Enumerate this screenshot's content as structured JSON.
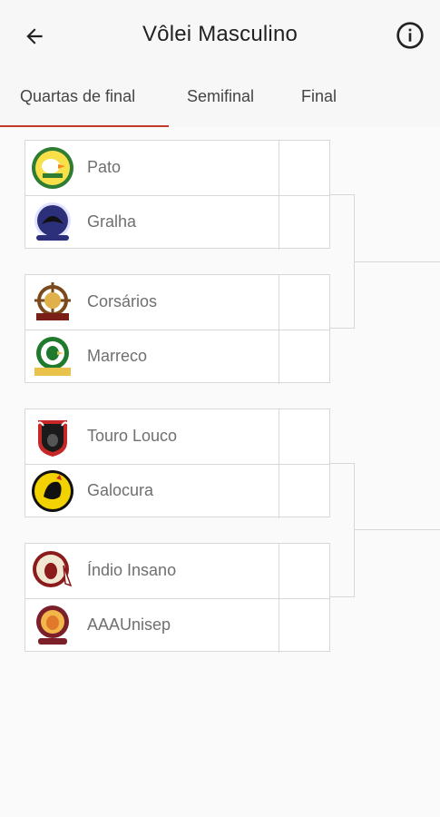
{
  "header": {
    "title": "Vôlei Masculino",
    "back_icon": "arrow-left-icon",
    "info_icon": "info-circle-icon"
  },
  "tabs": [
    {
      "label": "Quartas de final",
      "active": true
    },
    {
      "label": "Semifinal",
      "active": false
    },
    {
      "label": "Final",
      "active": false
    }
  ],
  "accent_color": "#c0392b",
  "matches": [
    {
      "teams": [
        {
          "name": "Pato",
          "logo_icon": "pato-logo",
          "colors": [
            "#2e7d32",
            "#f9e04b"
          ]
        },
        {
          "name": "Gralha",
          "logo_icon": "gralha-logo",
          "colors": [
            "#2c2f7a",
            "#dfe3ff"
          ]
        }
      ]
    },
    {
      "teams": [
        {
          "name": "Corsários",
          "logo_icon": "corsarios-logo",
          "colors": [
            "#7a1f16",
            "#e0b04a"
          ]
        },
        {
          "name": "Marreco",
          "logo_icon": "marreco-logo",
          "colors": [
            "#1f7a2e",
            "#e8c24a"
          ]
        }
      ]
    },
    {
      "teams": [
        {
          "name": "Touro Louco",
          "logo_icon": "touro-logo",
          "colors": [
            "#1a1a1a",
            "#c62828"
          ]
        },
        {
          "name": "Galocura",
          "logo_icon": "galocura-logo",
          "colors": [
            "#f2d200",
            "#111111"
          ]
        }
      ]
    },
    {
      "teams": [
        {
          "name": "Índio Insano",
          "logo_icon": "indio-logo",
          "colors": [
            "#8b1a1a",
            "#f0e6d2"
          ]
        },
        {
          "name": "AAAUnisep",
          "logo_icon": "unisep-logo",
          "colors": [
            "#7b1f2a",
            "#f2b64a"
          ]
        }
      ]
    }
  ]
}
